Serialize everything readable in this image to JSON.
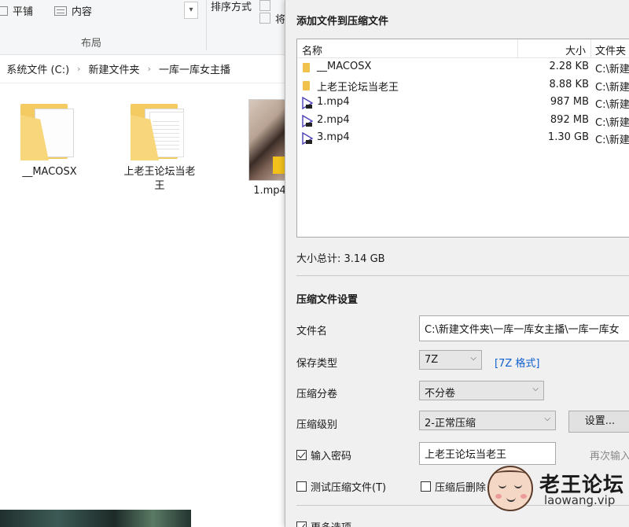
{
  "explorer": {
    "ribbon": {
      "tile_label": "平铺",
      "content_label": "内容",
      "scroll_arrow": "▾",
      "group_label": "布局",
      "sort_label": "排序方式",
      "partial_right": "将"
    },
    "breadcrumb": [
      "系统文件 (C:)",
      "新建文件夹",
      "一库一库女主播"
    ],
    "breadcrumb_sep": "›",
    "items": [
      {
        "name": "__MACOSX",
        "type": "folder"
      },
      {
        "name": "上老王论坛当老王",
        "name_line2": "王",
        "type": "folder"
      },
      {
        "name": "1.mp4",
        "type": "video"
      }
    ]
  },
  "dialog": {
    "title": "添加文件到压缩文件",
    "columns": {
      "name": "名称",
      "size": "大小",
      "path": "文件夹"
    },
    "files": [
      {
        "name": "__MACOSX",
        "size": "2.28 KB",
        "path": "C:\\新建",
        "type": "folder"
      },
      {
        "name": "上老王论坛当老王",
        "size": "8.88 KB",
        "path": "C:\\新建",
        "type": "folder"
      },
      {
        "name": "1.mp4",
        "size": "987 MB",
        "path": "C:\\新建",
        "type": "video"
      },
      {
        "name": "2.mp4",
        "size": "892 MB",
        "path": "C:\\新建",
        "type": "video"
      },
      {
        "name": "3.mp4",
        "size": "1.30 GB",
        "path": "C:\\新建",
        "type": "video"
      }
    ],
    "total_size": "大小总计: 3.14 GB",
    "settings_title": "压缩文件设置",
    "filename_label": "文件名",
    "filename_value": "C:\\新建文件夹\\一库一库女主播\\一库一库女",
    "save_type_label": "保存类型",
    "save_type_value": "7Z",
    "format_link": "[7Z 格式]",
    "split_label": "压缩分卷",
    "split_value": "不分卷",
    "level_label": "压缩级别",
    "level_value": "2-正常压缩",
    "settings_button": "设置...",
    "password_label": "输入密码",
    "password_value": "上老王论坛当老王",
    "reenter_label": "再次输入",
    "test_label": "测试压缩文件(T)",
    "delete_label": "压缩后删除",
    "more_options": "更多选项",
    "chevron": "⌵"
  },
  "watermark": {
    "text": "老王论坛",
    "url": "laowang.vip"
  },
  "colors": {
    "link": "#1060d0",
    "folder": "#f0c24c",
    "video_icon": "#4a3fb5"
  }
}
